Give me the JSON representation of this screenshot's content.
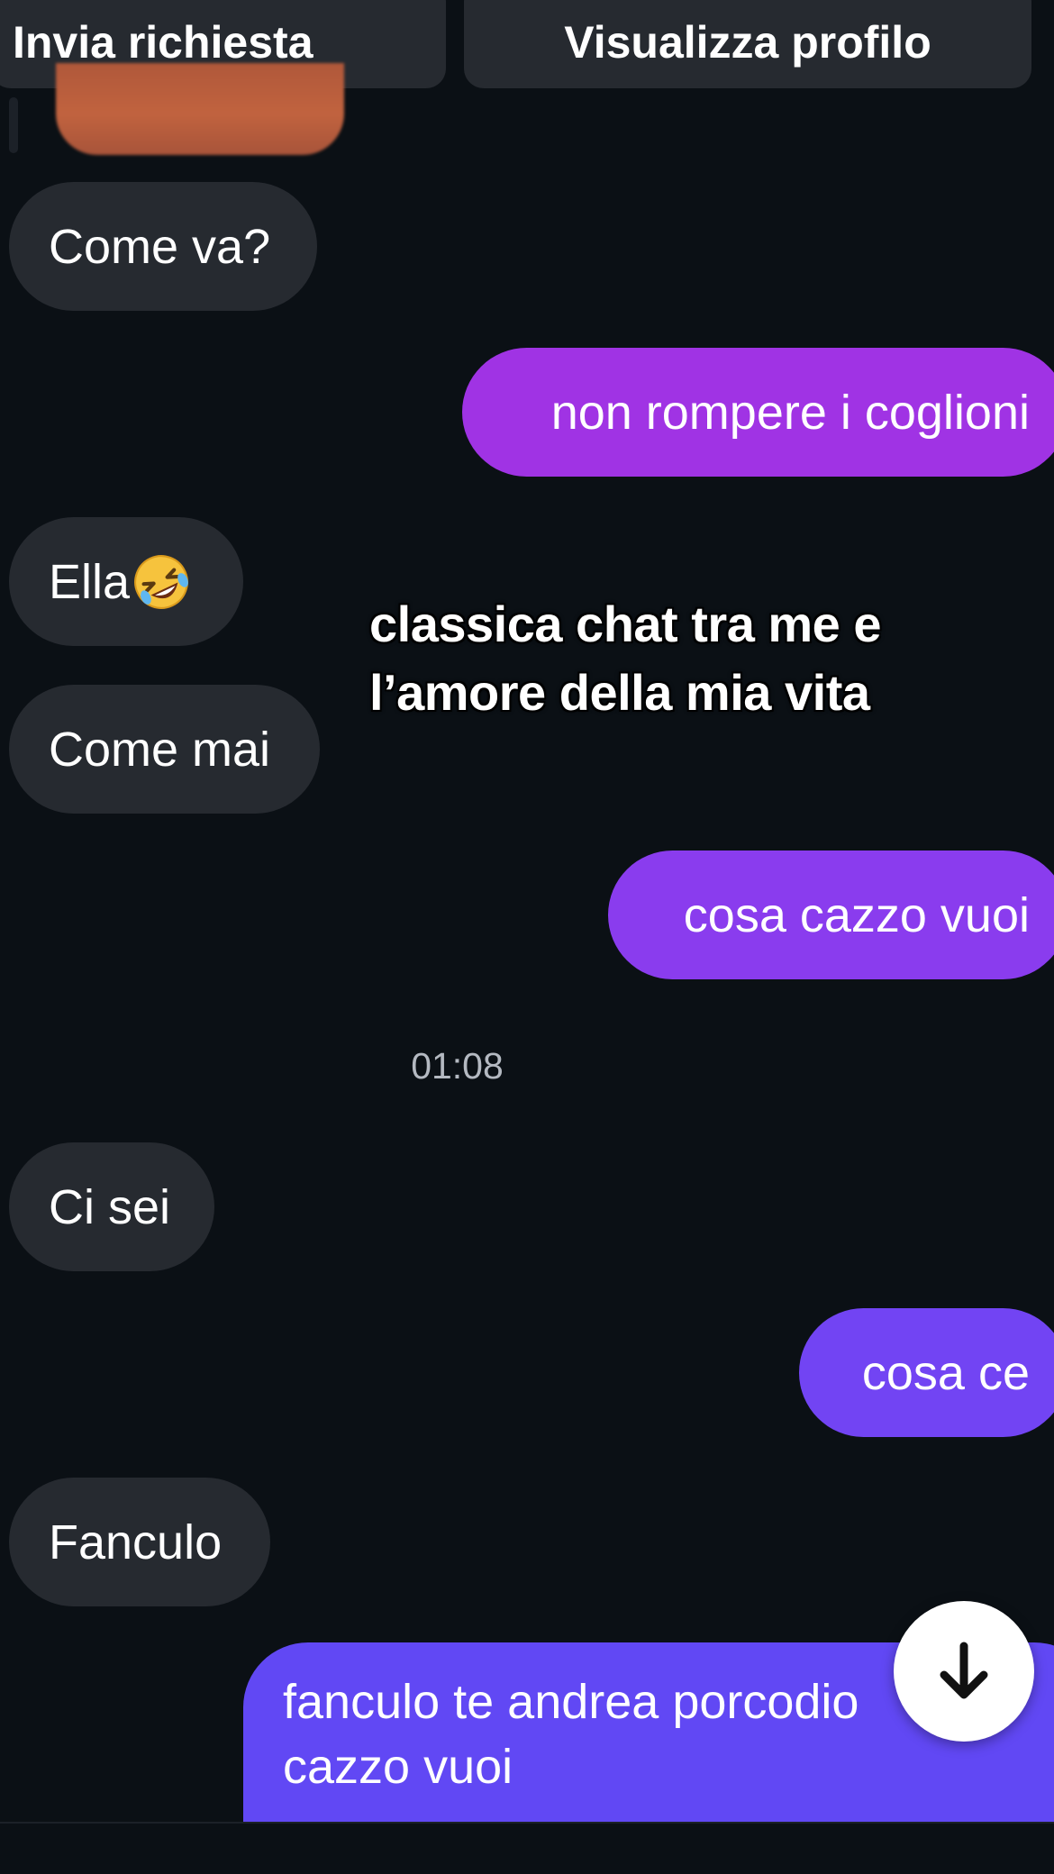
{
  "header": {
    "request_label": "Invia richiesta",
    "profile_label": "Visualizza profilo"
  },
  "messages": [
    {
      "side": "in",
      "text": "Come va?"
    },
    {
      "side": "out",
      "text": "non rompere i coglioni"
    },
    {
      "side": "in",
      "text": "Ella",
      "emoji": "rolling-on-floor-laughing-emoji"
    },
    {
      "side": "in",
      "text": "Come mai"
    },
    {
      "side": "out",
      "text": "cosa cazzo vuoi"
    },
    {
      "side": "in",
      "text": "Ci sei"
    },
    {
      "side": "out",
      "text": "cosa ce"
    },
    {
      "side": "in",
      "text": "Fanculo"
    },
    {
      "side": "out",
      "lines": [
        "fanculo te andrea porcodio",
        "cazzo vuoi"
      ]
    }
  ],
  "timestamp": "01:08",
  "overlay_caption": {
    "line1": "classica chat tra me e",
    "line2": "l’amore della mia vita"
  },
  "colors": {
    "background": "#0b1015",
    "incoming_bubble": "#262a30",
    "outgoing_bubble_top": "#a233e3",
    "outgoing_bubble_bottom": "#6148f4"
  },
  "icons": {
    "scroll_down": "arrow-down-icon"
  }
}
